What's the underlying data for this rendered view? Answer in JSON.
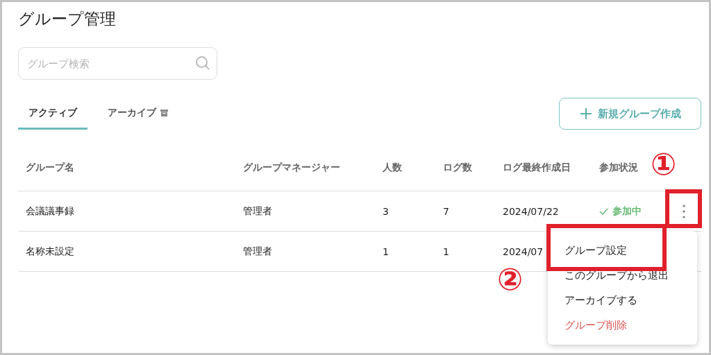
{
  "page": {
    "title": "グループ管理"
  },
  "search": {
    "placeholder": "グループ検索"
  },
  "tabs": [
    {
      "label": "アクティブ",
      "selected": true,
      "kind": "plain"
    },
    {
      "label": "アーカイブ",
      "selected": false,
      "kind": "archive"
    }
  ],
  "new_button": {
    "label": "新規グループ作成"
  },
  "table": {
    "columns": [
      "グループ名",
      "グループマネージャー",
      "人数",
      "ログ数",
      "ログ最終作成日",
      "参加状況"
    ],
    "rows": [
      {
        "cells": [
          "会議議事録",
          "管理者",
          "3",
          "7",
          "2024/07/22"
        ],
        "status": {
          "kind": "joined",
          "label": "参加中"
        },
        "menu_button": true
      },
      {
        "cells": [
          "名称未設定",
          "管理者",
          "1",
          "1",
          "2024/07"
        ]
      }
    ]
  },
  "menu": {
    "items": [
      {
        "label": "グループ設定",
        "kind": "normal"
      },
      {
        "label": "このグループから退出",
        "kind": "normal"
      },
      {
        "label": "アーカイブする",
        "kind": "normal"
      },
      {
        "label": "グループ削除",
        "kind": "danger"
      }
    ]
  },
  "annotations": [
    {
      "label": "①"
    },
    {
      "label": "②"
    }
  ]
}
